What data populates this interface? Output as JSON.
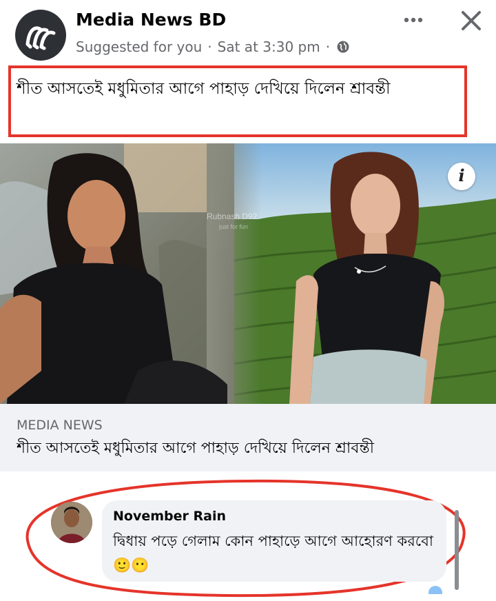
{
  "post": {
    "page_name": "Media News BD",
    "suggested": "Suggested for you",
    "separator": "·",
    "time": "Sat at 3:30 pm",
    "caption": "শীত আসতেই মধুমিতার আগে পাহাড় দেখিয়ে দিলেন শ্রাবন্তী",
    "more_icon": "more-dots-icon",
    "close_icon": "close-icon",
    "audience_icon": "globe-icon"
  },
  "image": {
    "watermark_line1": "Rubnash D92",
    "watermark_line2": "just for fun",
    "info_label": "i"
  },
  "link": {
    "domain": "MEDIA NEWS",
    "title": "শীত আসতেই মধুমিতার আগে পাহাড় দেখিয়ে দিলেন শ্রাবন্তী"
  },
  "comment": {
    "author": "November Rain",
    "text": "দ্বিধায় পড়ে গেলাম কোন পাহাড়ে আগে আহোরণ করবো🙂😶"
  },
  "colors": {
    "highlight_red": "#e5342a",
    "meta_gray": "#65676b",
    "bubble_bg": "#f0f2f5"
  }
}
